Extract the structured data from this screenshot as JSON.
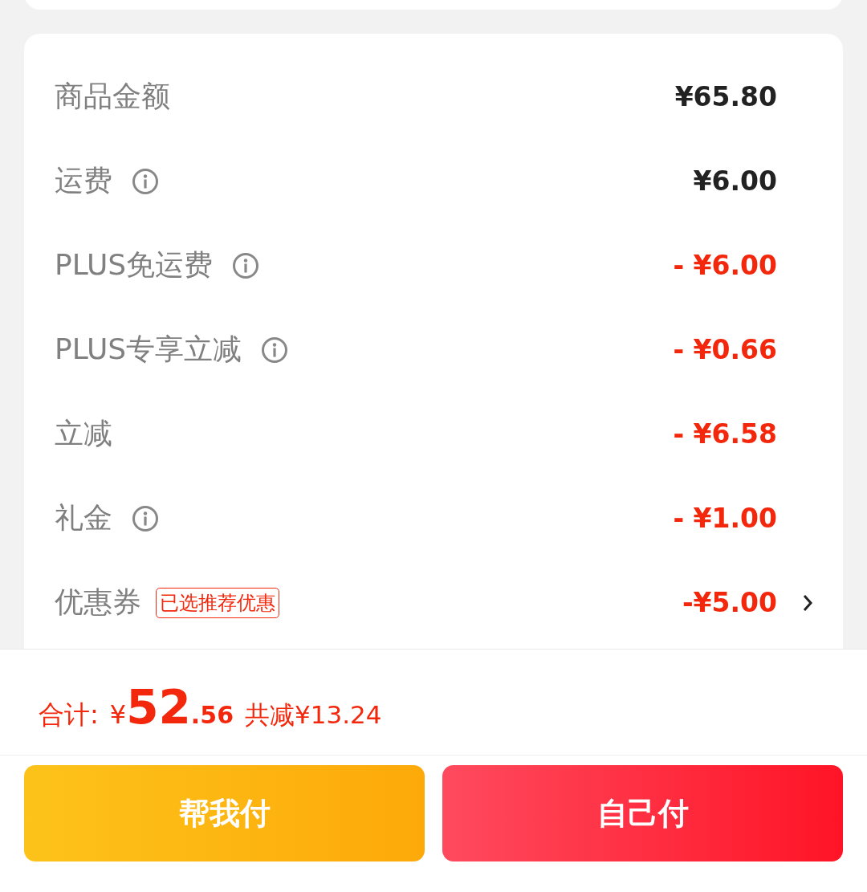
{
  "rows": [
    {
      "label": "商品金额",
      "info": false,
      "amount": "¥65.80",
      "kind": "charge"
    },
    {
      "label": "运费",
      "info": true,
      "amount": "¥6.00",
      "kind": "charge"
    },
    {
      "label": "PLUS免运费",
      "info": true,
      "amount": "- ¥6.00",
      "kind": "discount"
    },
    {
      "label": "PLUS专享立减",
      "info": true,
      "amount": "- ¥0.66",
      "kind": "discount"
    },
    {
      "label": "立减",
      "info": false,
      "amount": "- ¥6.58",
      "kind": "discount"
    },
    {
      "label": "礼金",
      "info": true,
      "amount": "- ¥1.00",
      "kind": "discount"
    },
    {
      "label": "优惠券",
      "info": false,
      "tag": "已选推荐优惠",
      "amount": "-¥5.00",
      "kind": "discount",
      "link": true
    }
  ],
  "total": {
    "label": "合计:",
    "currency": "¥",
    "integer": "52",
    "decimal": ".56",
    "savings": "共减¥13.24"
  },
  "buttons": [
    {
      "label": "帮我付",
      "kind": "friend"
    },
    {
      "label": "自己付",
      "kind": "self"
    }
  ]
}
